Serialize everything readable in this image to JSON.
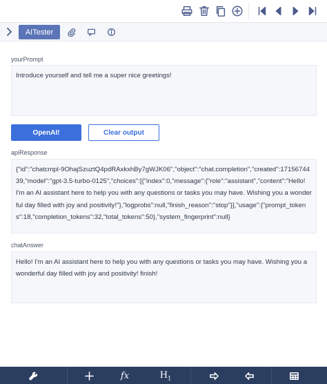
{
  "tabs": {
    "active_label": "AITester"
  },
  "prompt": {
    "label": "yourPrompt",
    "value": "Introduce yourself and tell me a super nice greetings!"
  },
  "buttons": {
    "primary_label": "OpenAI!",
    "secondary_label": "Clear output"
  },
  "api_response": {
    "label": "apiResponse",
    "value": "{\"id\":\"chatcmpl-9OhajSzuztQ4pdRAxkxhBy7gWJK06\",\"object\":\"chat.completion\",\"created\":1715674439,\"model\":\"gpt-3.5-turbo-0125\",\"choices\":[{\"index\":0,\"message\":{\"role\":\"assistant\",\"content\":\"Hello! I'm an AI assistant here to help you with any questions or tasks you may have. Wishing you a wonderful day filled with joy and positivity!\"},\"logprobs\":null,\"finish_reason\":\"stop\"}],\"usage\":{\"prompt_tokens\":18,\"completion_tokens\":32,\"total_tokens\":50},\"system_fingerprint\":null}"
  },
  "chat_answer": {
    "label": "chatAnswer",
    "value": "Hello! I'm an AI assistant here to help you with any questions or tasks you may have. Wishing you a wonderful day filled with joy and positivity! finish!"
  },
  "bottom_toolbar": {
    "fx_label": "fx",
    "h1_label": "H",
    "h1_sub": "1"
  },
  "icons": {
    "top": [
      "print-icon",
      "trash-icon",
      "copy-icon",
      "add-circle-icon",
      "first-page-icon",
      "previous-icon",
      "next-icon",
      "last-page-icon"
    ],
    "tabs": [
      "chevron-right-icon",
      "paperclip-icon",
      "comment-icon",
      "info-icon"
    ],
    "bottom": [
      "wrench-icon",
      "plus-icon",
      "function-icon",
      "heading-icon",
      "arrow-right-icon",
      "arrow-left-icon",
      "table-icon"
    ]
  },
  "colors": {
    "accent": "#3b6fdc",
    "tab_active": "#5b74b8",
    "bottom_bar": "#2c3e60"
  }
}
